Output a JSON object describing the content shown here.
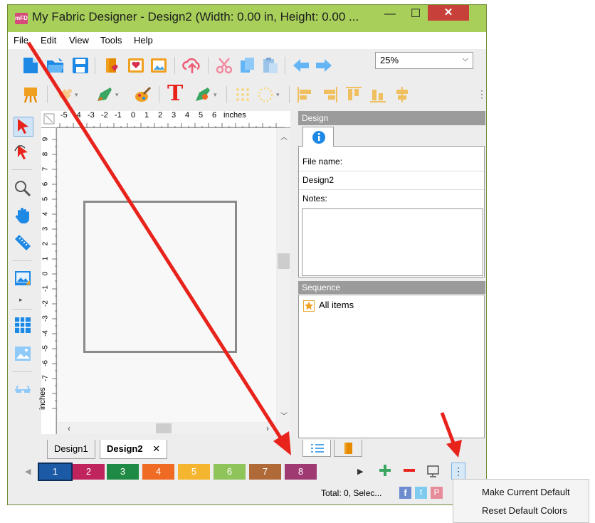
{
  "window": {
    "title": "My Fabric Designer - Design2 (Width: 0.00 in, Height: 0.00 ...",
    "app_icon_text": "mFD",
    "controls": {
      "minimize": "—",
      "maximize": "☐",
      "close": "✕"
    }
  },
  "menu": {
    "items": [
      "File",
      "Edit",
      "View",
      "Tools",
      "Help"
    ]
  },
  "toolbar": {
    "zoom_value": "25%"
  },
  "ruler": {
    "top_ticks": [
      "-5",
      "-4",
      "-3",
      "-2",
      "-1",
      "0",
      "1",
      "2",
      "3",
      "4",
      "5",
      "6"
    ],
    "top_unit": "inches",
    "left_ticks": [
      "9",
      "8",
      "7",
      "6",
      "5",
      "4",
      "3",
      "2",
      "1",
      "0",
      "-1",
      "-2",
      "-3",
      "-4",
      "-5",
      "-6",
      "-7"
    ],
    "left_unit": "inches"
  },
  "design_panel": {
    "header": "Design",
    "file_name_label": "File name:",
    "file_name_value": "Design2",
    "notes_label": "Notes:"
  },
  "sequence_panel": {
    "header": "Sequence",
    "items": [
      "All items"
    ]
  },
  "doc_tabs": {
    "tabs": [
      "Design1",
      "Design2"
    ],
    "active": "Design2",
    "close_glyph": "✕"
  },
  "color_swatches": [
    {
      "label": "1",
      "color": "#1c5aa6"
    },
    {
      "label": "2",
      "color": "#c0245c"
    },
    {
      "label": "3",
      "color": "#1f8a45"
    },
    {
      "label": "4",
      "color": "#ef6a23"
    },
    {
      "label": "5",
      "color": "#f5b52e"
    },
    {
      "label": "6",
      "color": "#8fc45b"
    },
    {
      "label": "7",
      "color": "#b06a38"
    },
    {
      "label": "8",
      "color": "#a03a72"
    }
  ],
  "status": {
    "text": "Total: 0, Selec..."
  },
  "context_menu": {
    "items": [
      "Make Current Default",
      "Reset Default Colors"
    ]
  },
  "colors": {
    "titlebar": "#a7cf5a",
    "annotation_arrow": "#e8231c",
    "accent_blue": "#1e88e5"
  }
}
